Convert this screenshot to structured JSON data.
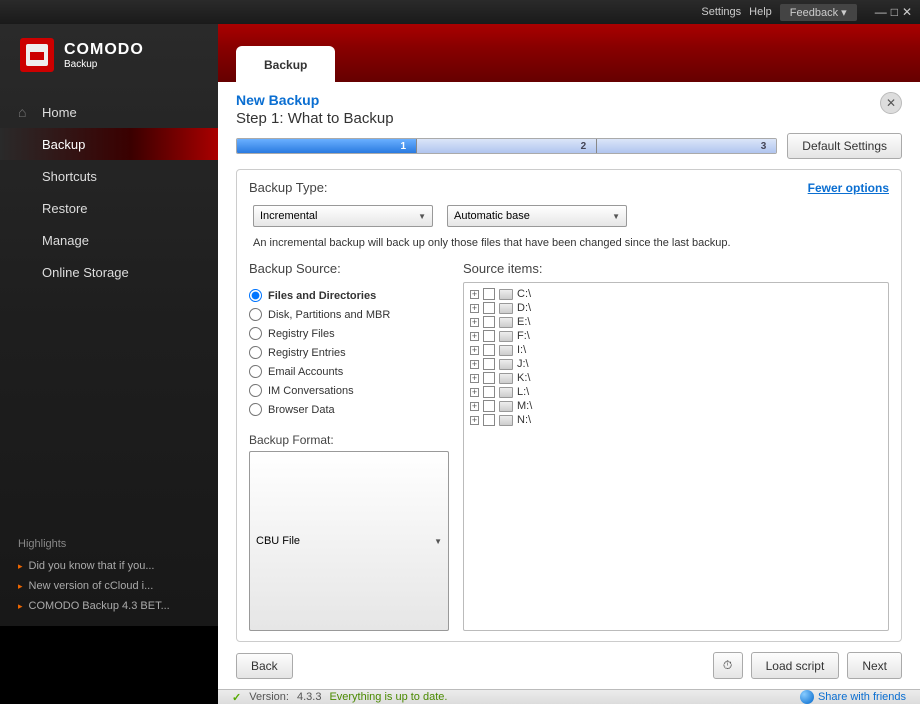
{
  "titlebar": {
    "settings": "Settings",
    "help": "Help",
    "feedback": "Feedback"
  },
  "brand": {
    "name": "COMODO",
    "sub": "Backup"
  },
  "nav": {
    "home": "Home",
    "items": [
      "Backup",
      "Shortcuts",
      "Restore",
      "Manage",
      "Online Storage"
    ],
    "active": "Backup"
  },
  "highlights": {
    "label": "Highlights",
    "items": [
      "Did you know that if you...",
      "New version of cCloud i...",
      "COMODO Backup 4.3 BET..."
    ]
  },
  "tab": {
    "label": "Backup"
  },
  "page": {
    "title": "New Backup",
    "step": "Step 1: What to Backup",
    "progress": [
      "1",
      "2",
      "3"
    ],
    "default_btn": "Default Settings",
    "type_label": "Backup Type:",
    "fewer": "Fewer options",
    "type_select": "Incremental",
    "base_select": "Automatic base",
    "desc": "An incremental backup will back up only those files that have been changed since the last backup.",
    "source_label": "Backup Source:",
    "items_label": "Source items:",
    "sources": [
      "Files and Directories",
      "Disk, Partitions and MBR",
      "Registry Files",
      "Registry Entries",
      "Email Accounts",
      "IM Conversations",
      "Browser Data"
    ],
    "source_selected": 0,
    "format_label": "Backup Format:",
    "format_select": "CBU File",
    "drives": [
      "C:\\",
      "D:\\",
      "E:\\",
      "F:\\",
      "I:\\",
      "J:\\",
      "K:\\",
      "L:\\",
      "M:\\",
      "N:\\"
    ]
  },
  "buttons": {
    "back": "Back",
    "load": "Load script",
    "next": "Next"
  },
  "status": {
    "version_label": "Version:",
    "version": "4.3.3",
    "msg": "Everything is up to date.",
    "share": "Share with friends"
  }
}
